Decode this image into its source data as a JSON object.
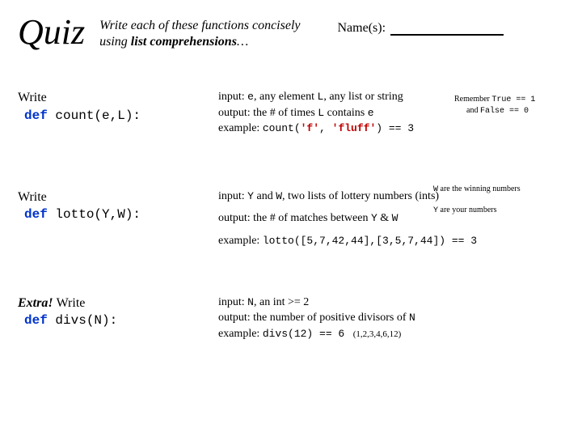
{
  "header": {
    "title": "Quiz",
    "instructions_line1": "Write each of these functions concisely",
    "instructions_line2_prefix": "using ",
    "instructions_line2_bold": "list comprehensions",
    "instructions_line2_suffix": "…",
    "names_label": "Name(s):"
  },
  "p1": {
    "left_write": "Write",
    "left_def_kw": "def ",
    "left_def_sig": "count(e,L):",
    "input_label": "input: ",
    "input_e": "e",
    "input_mid1": ", any element   ",
    "input_L": "L",
    "input_mid2": ", any list or string",
    "output_label": "output: the # of times ",
    "output_L": "L",
    "output_mid": "  contains ",
    "output_e": "e",
    "example_label": "example: ",
    "example_code_pre": "count(",
    "example_arg1": "'f'",
    "example_mid": ", ",
    "example_arg2": "'fluff'",
    "example_code_post": ") == 3",
    "note_line1_pre": "Remember ",
    "note_true": "True == 1",
    "note_line2_pre": "and ",
    "note_false": "False == 0"
  },
  "p2": {
    "left_write": "Write",
    "left_def_kw": "def ",
    "left_def_sig": "lotto(Y,W):",
    "input_label": "input: ",
    "input_Y": "Y",
    "input_mid1": " and ",
    "input_W": "W",
    "input_mid2": ", two lists of lottery numbers (ints)",
    "output_label": "output: the # of matches between ",
    "output_Y": "Y",
    "output_mid": " & ",
    "output_W": "W",
    "example_label": "example: ",
    "example_code": "lotto([5,7,42,44],[3,5,7,44]) == 3",
    "note_w_pre": "W",
    "note_w_rest": " are the winning numbers",
    "note_y_pre": "Y",
    "note_y_rest": " are your numbers"
  },
  "p3": {
    "left_extra": "Extra! ",
    "left_write": "Write",
    "left_def_kw": "def ",
    "left_def_sig": "divs(N):",
    "input_label": "input: ",
    "input_N": "N",
    "input_rest": ", an int >= 2",
    "output_label": "output: the number of positive divisors of ",
    "output_N": "N",
    "example_label": "example: ",
    "example_code": "divs(12) == 6",
    "example_list": "(1,2,3,4,6,12)"
  }
}
